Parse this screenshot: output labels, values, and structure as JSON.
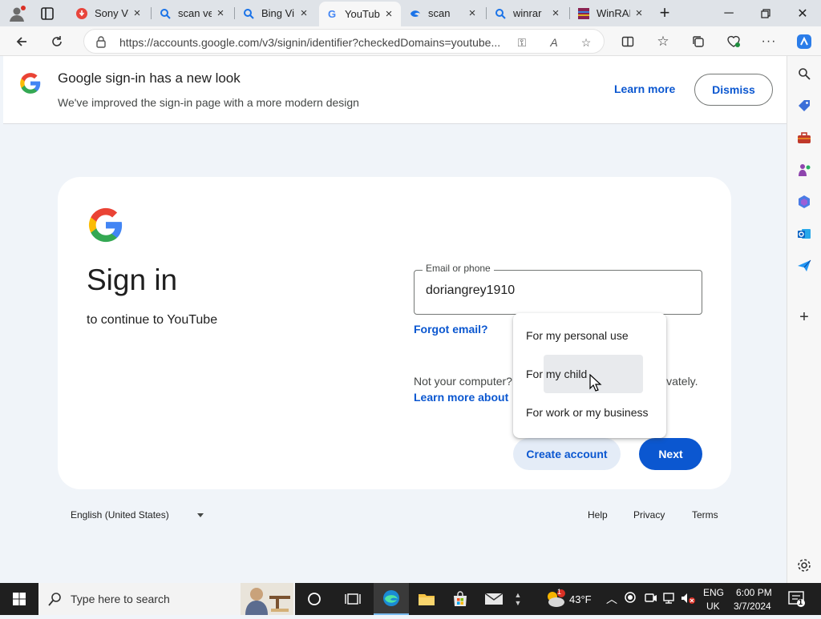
{
  "browser": {
    "tabs": [
      {
        "label": "Sony Ve",
        "icon": "sony-music-icon",
        "color": "#e8453c"
      },
      {
        "label": "scan ve",
        "icon": "bing-search-icon",
        "color": "#1a73e8"
      },
      {
        "label": "Bing Vi",
        "icon": "bing-search-icon",
        "color": "#1a73e8"
      },
      {
        "label": "YouTub",
        "icon": "google-g-icon",
        "color": "#4285f4"
      },
      {
        "label": "scan",
        "icon": "edge-drop-icon",
        "color": "#1a73e8"
      },
      {
        "label": "winrar",
        "icon": "bing-search-icon",
        "color": "#1a73e8"
      },
      {
        "label": "WinRAR",
        "icon": "winrar-icon",
        "color": "#8b2252"
      }
    ],
    "active_tab_index": 3,
    "url": "https://accounts.google.com/v3/signin/identifier?checkedDomains=youtube..."
  },
  "banner": {
    "title": "Google sign-in has a new look",
    "subtitle": "We've improved the sign-in page with a more modern design",
    "learn_more": "Learn more",
    "dismiss": "Dismiss"
  },
  "signin": {
    "title": "Sign in",
    "subtitle": "to continue to YouTube",
    "email_label": "Email or phone",
    "email_value": "doriangrey1910",
    "forgot_email": "Forgot email?",
    "guest_text_start": "Not your computer?",
    "guest_text_end": "ivately.",
    "guest_link": "Learn more about",
    "create_account": "Create account",
    "next": "Next"
  },
  "create_menu": {
    "items": [
      "For my personal use",
      "For my child",
      "For work or my business"
    ],
    "hovered_index": 1
  },
  "footer": {
    "language": "English (United States)",
    "links": [
      "Help",
      "Privacy",
      "Terms"
    ]
  },
  "taskbar": {
    "search_placeholder": "Type here to search",
    "weather_temp": "43°F",
    "weather_badge": "1",
    "lang_top": "ENG",
    "lang_bottom": "UK",
    "time": "6:00 PM",
    "date": "3/7/2024",
    "notification_count": "1"
  },
  "colors": {
    "google_blue": "#0b57d0",
    "page_bg": "#f0f4f9",
    "taskbar_bg": "#1f1f1f"
  }
}
